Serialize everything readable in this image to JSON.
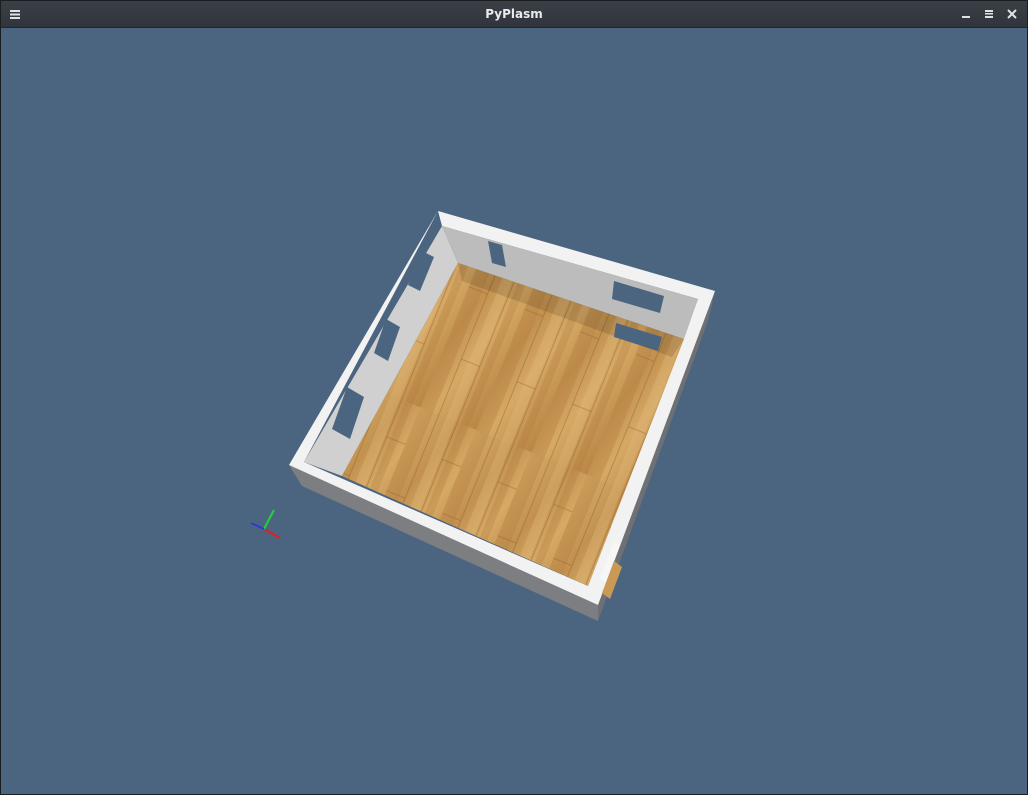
{
  "window": {
    "title": "PyPlasm",
    "controls": {
      "menu_icon": "hamburger-menu-icon",
      "minimize_icon": "minimize-icon",
      "maximize_icon": "maximize-icon",
      "close_icon": "close-icon"
    }
  },
  "viewport": {
    "background": "#4b6580",
    "scene": "3d-room-model",
    "axes_gizmo": {
      "x_color": "#e0201c",
      "y_color": "#22d13a",
      "z_color": "#2a3cd8"
    },
    "colors": {
      "wall_top": "#f2f2f2",
      "wall_inner": "#c9c9c9",
      "wall_outer": "#7c7e82",
      "floor": "#c99a55"
    }
  }
}
